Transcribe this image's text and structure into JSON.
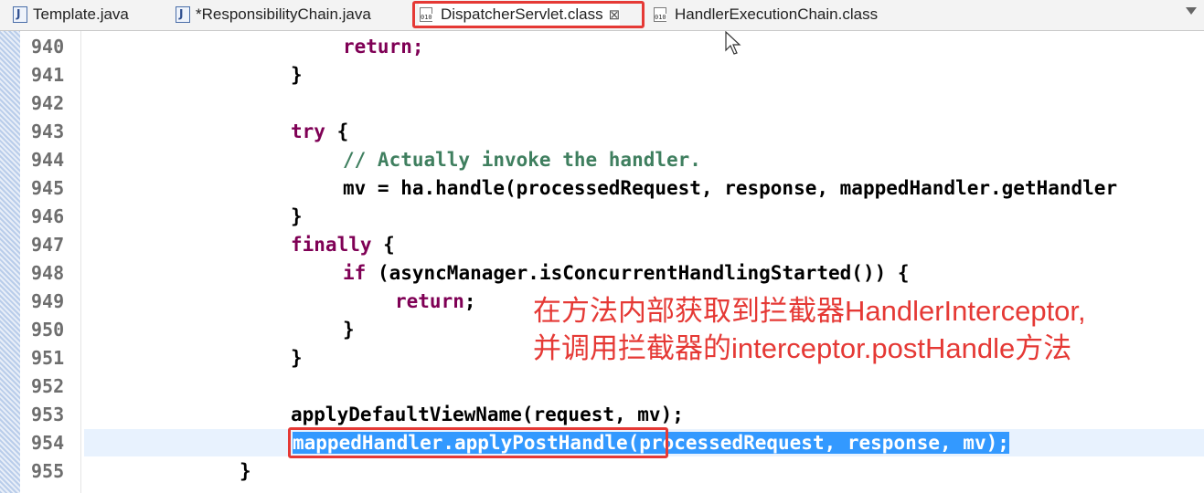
{
  "tabs": [
    {
      "label": "Template.java",
      "icon": "java-file-icon"
    },
    {
      "label": "*ResponsibilityChain.java",
      "icon": "java-file-icon"
    },
    {
      "label": "DispatcherServlet.class",
      "icon": "class-file-icon",
      "active": true
    },
    {
      "label": "HandlerExecutionChain.class",
      "icon": "class-file-icon"
    }
  ],
  "lines": [
    {
      "no": "940",
      "text": "return;"
    },
    {
      "no": "941",
      "text": "}"
    },
    {
      "no": "942",
      "text": ""
    },
    {
      "no": "943",
      "kw": "try",
      "text": " {"
    },
    {
      "no": "944",
      "comment": "// Actually invoke the handler."
    },
    {
      "no": "945",
      "text": "mv = ha.handle(processedRequest, response, mappedHandler.getHandler"
    },
    {
      "no": "946",
      "text": "}"
    },
    {
      "no": "947",
      "kw": "finally",
      "text": " {"
    },
    {
      "no": "948",
      "kw": "if",
      "text": " (asyncManager.isConcurrentHandlingStarted()) {"
    },
    {
      "no": "949",
      "kw": "return",
      "text": ";"
    },
    {
      "no": "950",
      "text": "}"
    },
    {
      "no": "951",
      "text": "}"
    },
    {
      "no": "952",
      "text": ""
    },
    {
      "no": "953",
      "text": "applyDefaultViewName(request, mv);"
    },
    {
      "no": "954",
      "sel_a": "mappedHandler.applyPostHandle",
      "sel_b": "(processedRequest, response, mv);"
    },
    {
      "no": "955",
      "text": "}"
    }
  ],
  "annotation": {
    "line1": "在方法内部获取到拦截器HandlerInterceptor,",
    "line2": "并调用拦截器的interceptor.postHandle方法"
  },
  "colors": {
    "keyword": "#7f0055",
    "comment": "#3f7f5f",
    "selection": "#3399ff",
    "highlight_box": "#e53935",
    "annotation": "#e53935"
  }
}
